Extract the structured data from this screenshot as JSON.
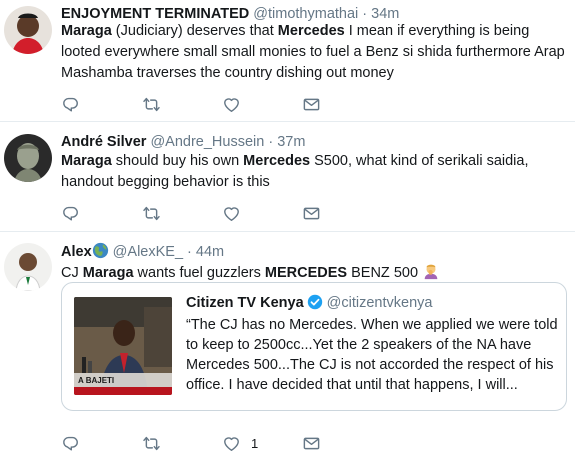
{
  "tweets": [
    {
      "name": "ENJOYMENT TERMINATED",
      "handle": "@timothymathai",
      "time": "· 34m",
      "b1": "Maraga",
      "t1": " (Judiciary) deserves that ",
      "b2": "Mercedes",
      "t2": " I mean if everything is being looted everywhere small small monies to fuel a Benz si shida furthermore Arap Mashamba traverses the country dishing out money"
    },
    {
      "name": "André Silver",
      "handle": "@Andre_Hussein",
      "time": "· 37m",
      "b1": "Maraga",
      "t1": " should buy his own ",
      "b2": "Mercedes",
      "t2": " S500, what kind of serikali saidia, handout begging behavior is this"
    },
    {
      "name": "Alex",
      "handle": "@AlexKE_",
      "time": "· 44m",
      "t0": "CJ ",
      "b1": "Maraga",
      "t1": " wants fuel guzzlers ",
      "b2": "MERCEDES",
      "t2": " BENZ 500",
      "like_count": "1",
      "quote": {
        "name": "Citizen TV Kenya",
        "handle": "@citizentvkenya",
        "text": "“The CJ has no Mercedes. When we applied we were told to keep to  2500cc...Yet the 2 speakers of the NA have Mercedes 500...The CJ is not accorded the respect of his office. I have decided that until that happens, I will...",
        "image_caption": "A  BAJETI"
      }
    }
  ],
  "icons": {
    "reply": "reply-icon",
    "retweet": "retweet-icon",
    "like": "heart-icon",
    "dm": "envelope-icon",
    "verified": "verified-badge-icon",
    "globe": "globe-emoji-icon",
    "facepalm": "facepalm-emoji-icon"
  },
  "colors": {
    "text": "#14171a",
    "secondary": "#657786",
    "border": "#e6ecf0",
    "verified": "#1da1f2"
  }
}
